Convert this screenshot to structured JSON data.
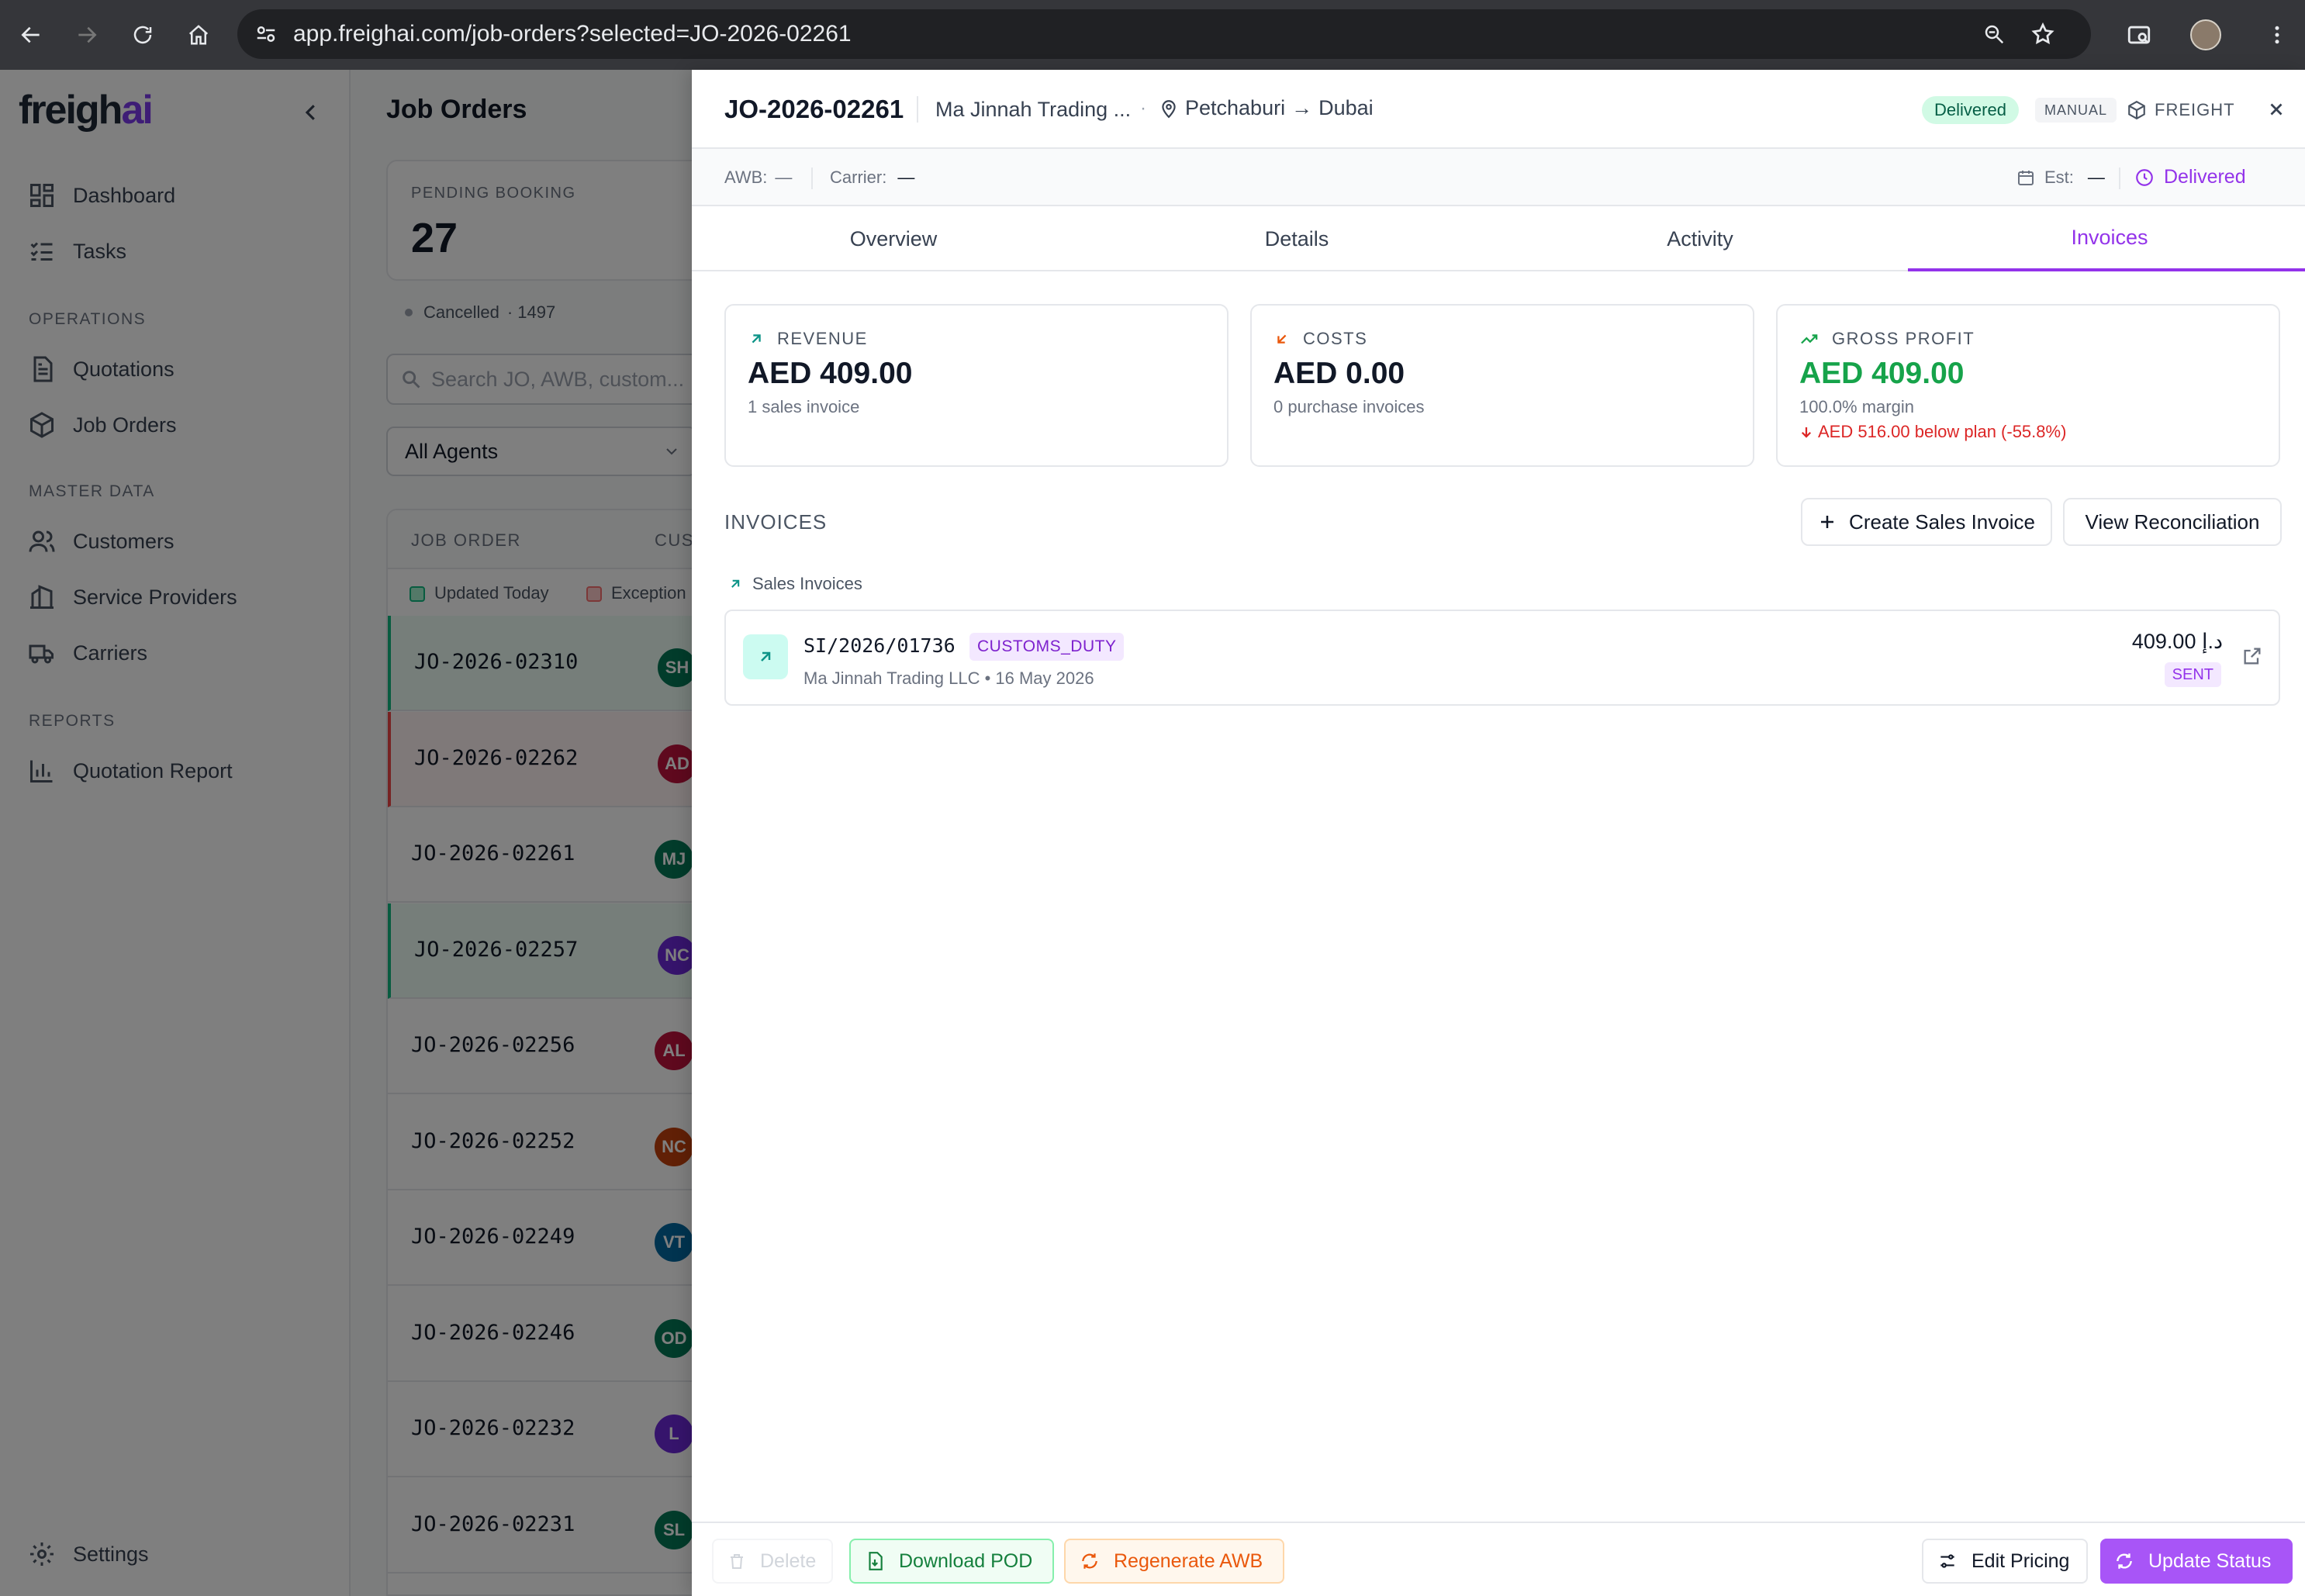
{
  "browser": {
    "url": "app.freighai.com/job-orders?selected=JO-2026-02261"
  },
  "sidebar": {
    "logo_main": "freigh",
    "logo_accent": "ai",
    "items_top": [
      {
        "label": "Dashboard",
        "icon": "dashboard-icon"
      },
      {
        "label": "Tasks",
        "icon": "list-icon"
      }
    ],
    "section_operations": "OPERATIONS",
    "items_operations": [
      {
        "label": "Quotations",
        "icon": "document-icon"
      },
      {
        "label": "Job Orders",
        "icon": "package-icon"
      }
    ],
    "section_master": "MASTER DATA",
    "items_master": [
      {
        "label": "Customers",
        "icon": "users-icon"
      },
      {
        "label": "Service Providers",
        "icon": "building-icon"
      },
      {
        "label": "Carriers",
        "icon": "truck-icon"
      }
    ],
    "section_reports": "REPORTS",
    "items_reports": [
      {
        "label": "Quotation Report",
        "icon": "bar-chart-icon"
      }
    ],
    "settings_label": "Settings"
  },
  "main": {
    "title": "Job Orders",
    "stat_label": "PENDING BOOKING",
    "stat_value": "27",
    "legend_cancelled": "Cancelled",
    "legend_count": "· 1497",
    "search_placeholder": "Search JO, AWB, custom...",
    "agent_filter": "All Agents",
    "col_job_order": "JOB ORDER",
    "col_customer": "CUS",
    "legend_updated": "Updated Today",
    "legend_exception": "Exception",
    "rows": [
      {
        "jo": "JO-2026-02310",
        "initials": "SH",
        "color": "#047857",
        "bg": "#ecfdf5",
        "border": "#10b981"
      },
      {
        "jo": "JO-2026-02262",
        "initials": "AD",
        "color": "#be123c",
        "bg": "#fef2f2",
        "border": "#ef4444"
      },
      {
        "jo": "JO-2026-02261",
        "initials": "MJ",
        "color": "#047857",
        "bg": "#ffffff",
        "border": ""
      },
      {
        "jo": "JO-2026-02257",
        "initials": "NC",
        "color": "#6d28d9",
        "bg": "#ecfdf5",
        "border": "#10b981"
      },
      {
        "jo": "JO-2026-02256",
        "initials": "AL",
        "color": "#be123c",
        "bg": "#ffffff",
        "border": ""
      },
      {
        "jo": "JO-2026-02252",
        "initials": "NC",
        "color": "#c2410c",
        "bg": "#ffffff",
        "border": ""
      },
      {
        "jo": "JO-2026-02249",
        "initials": "VT",
        "color": "#0369a1",
        "bg": "#ffffff",
        "border": ""
      },
      {
        "jo": "JO-2026-02246",
        "initials": "OD",
        "color": "#047857",
        "bg": "#ffffff",
        "border": ""
      },
      {
        "jo": "JO-2026-02232",
        "initials": "L",
        "color": "#6d28d9",
        "bg": "#ffffff",
        "border": ""
      },
      {
        "jo": "JO-2026-02231",
        "initials": "SL",
        "color": "#047857",
        "bg": "#ffffff",
        "border": ""
      }
    ]
  },
  "panel": {
    "job_order": "JO-2026-02261",
    "customer": "Ma Jinnah Trading ...",
    "dot": "·",
    "origin": "Petchaburi",
    "arrow": "→",
    "destination": "Dubai",
    "status_badge": "Delivered",
    "mode_badge": "MANUAL",
    "type_badge": "FREIGHT",
    "awb_label": "AWB:",
    "awb_value": "—",
    "carrier_label": "Carrier:",
    "carrier_value": "—",
    "est_label": "Est:",
    "est_value": "—",
    "status_text": "Delivered",
    "tabs": [
      "Overview",
      "Details",
      "Activity",
      "Invoices"
    ],
    "active_tab": "Invoices",
    "kpis": {
      "revenue": {
        "label": "REVENUE",
        "value": "AED 409.00",
        "sub": "1 sales invoice"
      },
      "costs": {
        "label": "COSTS",
        "value": "AED 0.00",
        "sub": "0 purchase invoices"
      },
      "profit": {
        "label": "GROSS PROFIT",
        "value": "AED 409.00",
        "sub": "100.0% margin",
        "warning": "AED 516.00 below plan (-55.8%)"
      }
    },
    "invoices_title": "INVOICES",
    "create_sales_label": "Create Sales Invoice",
    "view_reconciliation_label": "View Reconciliation",
    "sales_section": "Sales Invoices",
    "invoice": {
      "number": "SI/2026/01736",
      "tag": "CUSTOMS_DUTY",
      "meta": "Ma Jinnah Trading LLC • 16 May 2026",
      "amount": "409.00 د.إ",
      "status": "SENT"
    },
    "footer": {
      "delete": "Delete",
      "download_pod": "Download POD",
      "regenerate_awb": "Regenerate AWB",
      "edit_pricing": "Edit Pricing",
      "update_status": "Update Status"
    }
  },
  "colors": {
    "accent": "#9333ea",
    "revenue": "#0d9488",
    "cost": "#ea580c",
    "profit": "#16a34a",
    "danger": "#dc2626"
  }
}
